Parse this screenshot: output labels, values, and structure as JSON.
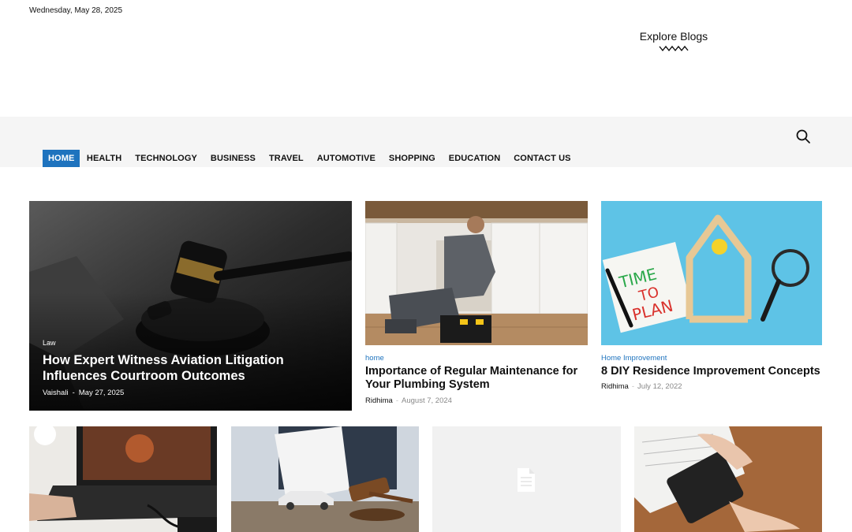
{
  "topbar": {
    "date": "Wednesday, May 28, 2025"
  },
  "brand": {
    "title": "Explore Blogs"
  },
  "nav": {
    "items": [
      "HOME",
      "HEALTH",
      "TECHNOLOGY",
      "BUSINESS",
      "TRAVEL",
      "AUTOMOTIVE",
      "SHOPPING",
      "EDUCATION",
      "CONTACT US"
    ],
    "active": "HOME",
    "search_icon": "search-icon"
  },
  "featured": {
    "category": "Law",
    "title": "How Expert Witness Aviation Litigation Influences Courtroom Outcomes",
    "author": "Vaishali",
    "separator": "-",
    "date": "May 27, 2025"
  },
  "cards": [
    {
      "category": "home",
      "title": "Importance of Regular Maintenance for Your Plumbing System",
      "author": "Ridhima",
      "separator": "-",
      "date": "August 7, 2024"
    },
    {
      "category": "Home Improvement",
      "title": "8 DIY Residence Improvement Concepts",
      "author": "Ridhima",
      "separator": "-",
      "date": "July 12, 2022",
      "image_text": [
        "TIME",
        "TO",
        "PLAN"
      ]
    }
  ],
  "colors": {
    "accent": "#1e73be",
    "menu_bg": "#f5f5f5"
  }
}
